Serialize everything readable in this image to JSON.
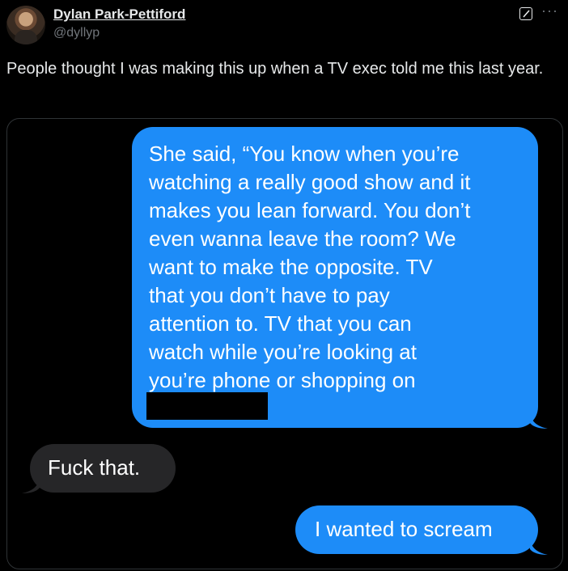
{
  "author": {
    "name": "Dylan Park-Pettiford",
    "handle": "@dyllyp"
  },
  "tweet": {
    "text": "People thought I was making this up when a TV exec told me this last year."
  },
  "actions": {
    "more_label": "···"
  },
  "media": {
    "messages": [
      {
        "side": "right",
        "color": "#1d8cf8",
        "text": "She said, “You know when you’re\nwatching a really good show and it\nmakes you lean forward. You don’t\neven wanna leave the room? We\nwant to make the opposite. TV\nthat you don’t have to pay\nattention to. TV that you can\nwatch while you’re looking at\nyou’re phone or shopping on"
      },
      {
        "side": "left",
        "color": "#262628",
        "text": "Fuck that."
      },
      {
        "side": "right",
        "color": "#1d8cf8",
        "text": "I wanted to scream"
      }
    ]
  }
}
